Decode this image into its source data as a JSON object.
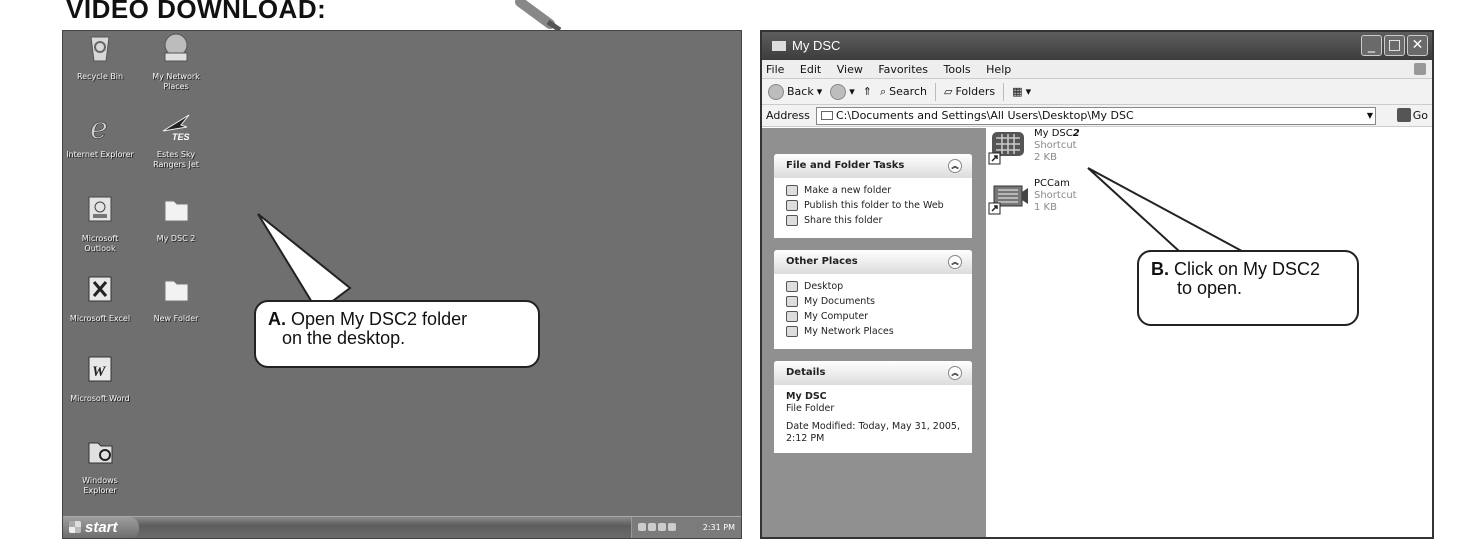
{
  "heading": "VIDEO DOWNLOAD:",
  "desktop": {
    "icons": [
      {
        "label": "Recycle Bin",
        "icon": "recycle-bin-icon"
      },
      {
        "label": "My Network Places",
        "icon": "network-places-icon"
      },
      {
        "label": "Internet Explorer",
        "icon": "internet-explorer-icon"
      },
      {
        "label": "Estes Sky Rangers Jet",
        "icon": "estes-jet-icon"
      },
      {
        "label": "Microsoft Outlook",
        "icon": "outlook-icon"
      },
      {
        "label": "My DSC 2",
        "icon": "folder-icon"
      },
      {
        "label": "Microsoft Excel",
        "icon": "excel-icon"
      },
      {
        "label": "New Folder",
        "icon": "folder-icon"
      },
      {
        "label": "Microsoft Word",
        "icon": "word-icon"
      },
      {
        "label": "Windows Explorer",
        "icon": "windows-explorer-icon"
      }
    ],
    "taskbar": {
      "start_label": "start",
      "clock": "2:31 PM"
    }
  },
  "callout_a": {
    "letter": "A.",
    "line1": "Open My DSC2 folder",
    "line2": "on the desktop."
  },
  "explorer": {
    "title": "My DSC",
    "menu": [
      "File",
      "Edit",
      "View",
      "Favorites",
      "Tools",
      "Help"
    ],
    "toolbar": {
      "back": "Back",
      "search": "Search",
      "folders": "Folders"
    },
    "address": {
      "label": "Address",
      "path": "C:\\Documents and Settings\\All Users\\Desktop\\My DSC",
      "go": "Go"
    },
    "panels": {
      "file_tasks": {
        "title": "File and Folder Tasks",
        "items": [
          "Make a new folder",
          "Publish this folder to the Web",
          "Share this folder"
        ]
      },
      "other_places": {
        "title": "Other Places",
        "items": [
          "Desktop",
          "My Documents",
          "My Computer",
          "My Network Places"
        ]
      },
      "details": {
        "title": "Details",
        "name": "My DSC",
        "type": "File Folder",
        "modified": "Date Modified: Today, May 31, 2005, 2:12 PM"
      }
    },
    "files": [
      {
        "name": "My DSC",
        "name_suffix": "2",
        "type": "Shortcut",
        "size": "2 KB"
      },
      {
        "name": "PCCam",
        "type": "Shortcut",
        "size": "1 KB"
      }
    ]
  },
  "callout_b": {
    "letter": "B.",
    "line1": "Click on My DSC2",
    "line2": "to open."
  }
}
